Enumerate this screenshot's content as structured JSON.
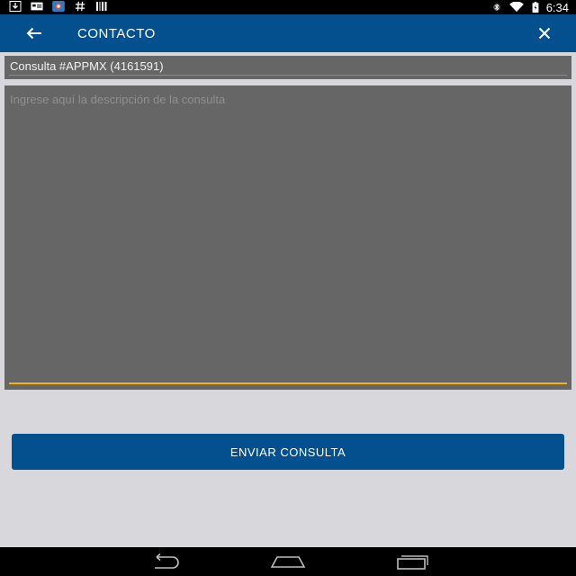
{
  "status_bar": {
    "time": "6:34",
    "left_icons": [
      "download-icon",
      "card-icon",
      "app-icon",
      "hash-icon",
      "barcode-icon"
    ],
    "right_icons": [
      "bluetooth-icon",
      "wifi-icon",
      "battery-icon"
    ]
  },
  "app_bar": {
    "title": "CONTACTO",
    "back_icon": "arrow-left-icon",
    "close_icon": "close-icon",
    "color": "#04508f"
  },
  "form": {
    "subject_value": "Consulta #APPMX (4161591)",
    "description_placeholder": "Ingrese aquí la descripción de la consulta",
    "field_color": "#666666",
    "focus_color": "#f5b400"
  },
  "submit_button": {
    "label": "ENVIAR CONSULTA"
  },
  "nav_bar": {
    "buttons": [
      "back-nav-icon",
      "home-nav-icon",
      "recents-nav-icon"
    ]
  }
}
